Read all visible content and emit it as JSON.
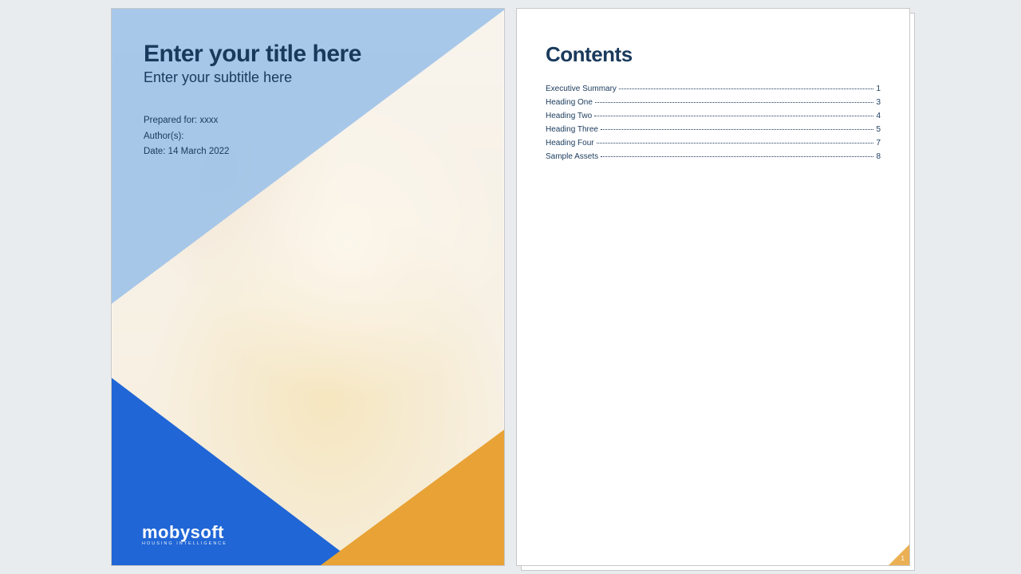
{
  "cover": {
    "title": "Enter your title here",
    "subtitle": "Enter your subtitle here",
    "prepared_for": "Prepared for: xxxx",
    "authors": "Author(s):",
    "date": "Date: 14 March 2022",
    "brand_name": "mobysoft",
    "brand_tagline": "HOUSING INTELLIGENCE"
  },
  "toc": {
    "heading": "Contents",
    "items": [
      {
        "label": "Executive Summary",
        "page": "1"
      },
      {
        "label": "Heading One",
        "page": "3"
      },
      {
        "label": "Heading Two",
        "page": "4"
      },
      {
        "label": "Heading Three",
        "page": "5"
      },
      {
        "label": "Heading Four",
        "page": "7"
      },
      {
        "label": "Sample Assets",
        "page": "8"
      }
    ],
    "page_number": "1"
  }
}
